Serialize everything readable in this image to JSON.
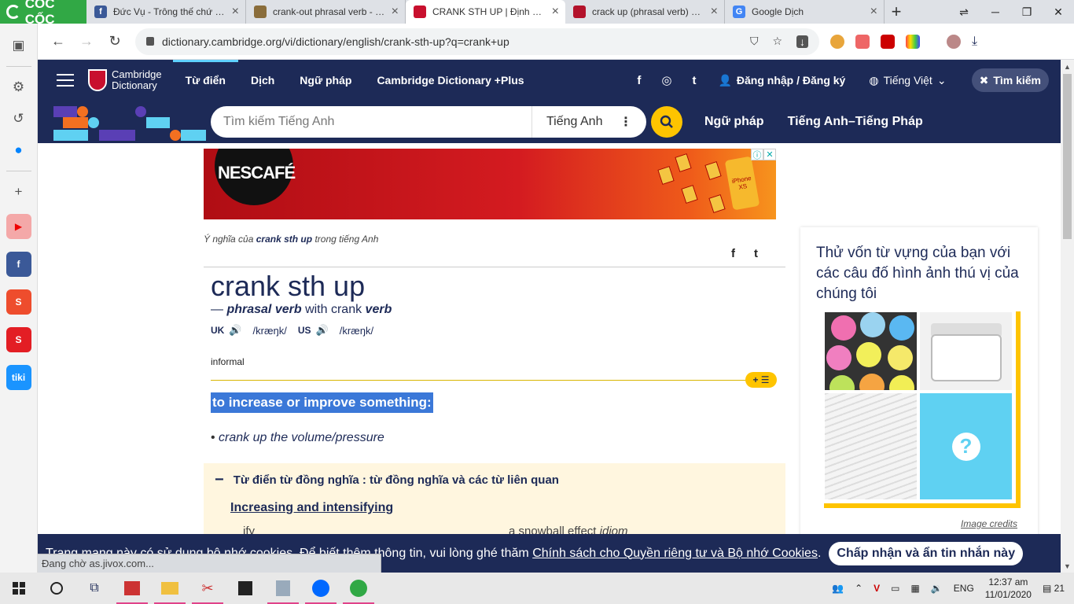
{
  "browser": {
    "brand": "CỐC CỐC",
    "tabs": [
      {
        "title": "Đức Vụ - Trông thế chứ có l",
        "fav_color": "#3b5998",
        "fav": "f"
      },
      {
        "title": "crank-out phrasal verb - De",
        "fav_color": "#8a6d3b",
        "fav": ""
      },
      {
        "title": "CRANK STH UP | Định nghĩa",
        "fav_color": "#c8102e",
        "fav": ""
      },
      {
        "title": "crack up (phrasal verb) defi",
        "fav_color": "#b3122b",
        "fav": ""
      },
      {
        "title": "Google Dịch",
        "fav_color": "#4285f4",
        "fav": "G"
      }
    ],
    "url": "dictionary.cambridge.org/vi/dictionary/english/crank-sth-up?q=crank+up"
  },
  "site": {
    "brand_line1": "Cambridge",
    "brand_line2": "Dictionary",
    "nav": [
      "Từ điển",
      "Dịch",
      "Ngữ pháp",
      "Cambridge Dictionary +Plus"
    ],
    "social": [
      "f",
      "◎",
      "t"
    ],
    "login": "Đăng nhập / Đăng ký",
    "language": "Tiếng Việt",
    "search_btn": "Tìm kiếm",
    "search_placeholder": "Tìm kiếm Tiếng Anh",
    "search_lang": "Tiếng Anh",
    "band_links": [
      "Ngữ pháp",
      "Tiếng Anh–Tiếng Pháp"
    ]
  },
  "ad": {
    "brand": "NESCAFÉ",
    "phone_text": "iPhone XS"
  },
  "entry": {
    "crumb_pre": "Ý nghĩa của",
    "crumb_word": "crank sth up",
    "crumb_post": "trong tiếng Anh",
    "headword": "crank sth up",
    "pos_dash": "—",
    "pos": "phrasal verb",
    "pos_with": "with crank",
    "pos_verb": "verb",
    "uk": "UK",
    "uk_ipa": "/kræŋk/",
    "us": "US",
    "us_ipa": "/kræŋk/",
    "register": "informal",
    "definition": "to increase or improve something:",
    "example": "crank up the volume/pressure"
  },
  "thesaurus": {
    "heading": "Từ điển từ đồng nghĩa : từ đồng nghĩa và các từ liên quan",
    "subheading": "Increasing and intensifying",
    "word1": "ify",
    "word2": "a snowball effect",
    "word2_tag": "idiom"
  },
  "quiz": {
    "title": "Thử vốn từ vựng của bạn với các câu đố hình ảnh thú vị của chúng tôi",
    "credits": "Image credits",
    "dot_colors": [
      "#f06fb0",
      "#9ad3f0",
      "#f2ef5a",
      "#5ab8f2",
      "#f07fc0",
      "#f5e96a",
      "#bde25b",
      "#f5a442",
      "#f2ee55"
    ]
  },
  "cookie": {
    "text": "Trang mạng này có sử dụng bộ nhớ cookies. Để biết thêm thông tin, vui lòng ghé thăm ",
    "link": "Chính sách cho Quyền riêng tư và Bộ nhớ Cookies",
    "end": ".",
    "accept": "Chấp nhận và ẩn tin nhắn này"
  },
  "status_text": "Đang chờ as.jivox.com...",
  "taskbar": {
    "lang": "ENG",
    "time": "12:37 am",
    "date": "11/01/2020",
    "notif": "21"
  }
}
